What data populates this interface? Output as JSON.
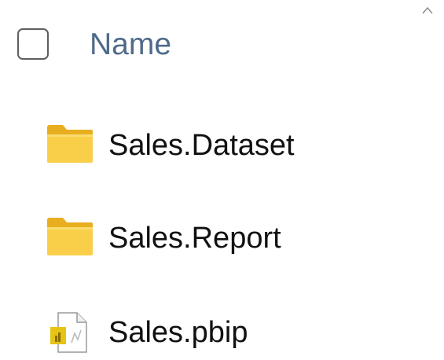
{
  "list": {
    "column_header": "Name",
    "sort_direction": "ascending",
    "items": [
      {
        "label": "Sales.Dataset",
        "icon": "folder-icon",
        "type": "folder"
      },
      {
        "label": "Sales.Report",
        "icon": "folder-icon",
        "type": "folder"
      },
      {
        "label": "Sales.pbip",
        "icon": "pbip-file-icon",
        "type": "file"
      }
    ]
  },
  "colors": {
    "header_text": "#4f6a8a",
    "folder_front": "#f9cf49",
    "folder_back": "#e8ae1f",
    "file_accent": "#e5c414"
  }
}
